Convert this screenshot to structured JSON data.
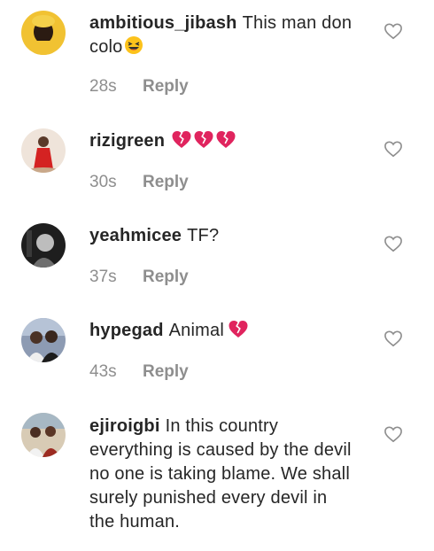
{
  "comments": [
    {
      "username": "ambitious_jibash",
      "text": "This man don colo",
      "emojis": [
        "laughing-face"
      ],
      "time": "28s",
      "reply_label": "Reply",
      "avatar_colors": [
        "#f4c430",
        "#111111"
      ]
    },
    {
      "username": "rizigreen",
      "text": "",
      "emojis": [
        "broken-heart",
        "broken-heart",
        "broken-heart"
      ],
      "time": "30s",
      "reply_label": "Reply",
      "avatar_colors": [
        "#f3e6d8",
        "#d62020"
      ]
    },
    {
      "username": "yeahmicee",
      "text": "TF?",
      "emojis": [],
      "time": "37s",
      "reply_label": "Reply",
      "avatar_colors": [
        "#2a2a2a",
        "#dddddd"
      ]
    },
    {
      "username": "hypegad",
      "text": "Animal",
      "emojis": [
        "broken-heart"
      ],
      "time": "43s",
      "reply_label": "Reply",
      "avatar_colors": [
        "#6b7fa0",
        "#3a2b24"
      ]
    },
    {
      "username": "ejiroigbi",
      "text_lines": [
        "In this country",
        "everything is caused by the devil",
        "no one is taking blame. We shall",
        "surely punished every devil in",
        "the human."
      ],
      "emojis": [],
      "time": "",
      "reply_label": "",
      "avatar_colors": [
        "#c9b9a0",
        "#8a3a2a"
      ]
    }
  ],
  "colors": {
    "text": "#262626",
    "meta": "#8e8e8e",
    "heart_outline": "#8e8e8e",
    "broken_heart": "#e0245e"
  }
}
